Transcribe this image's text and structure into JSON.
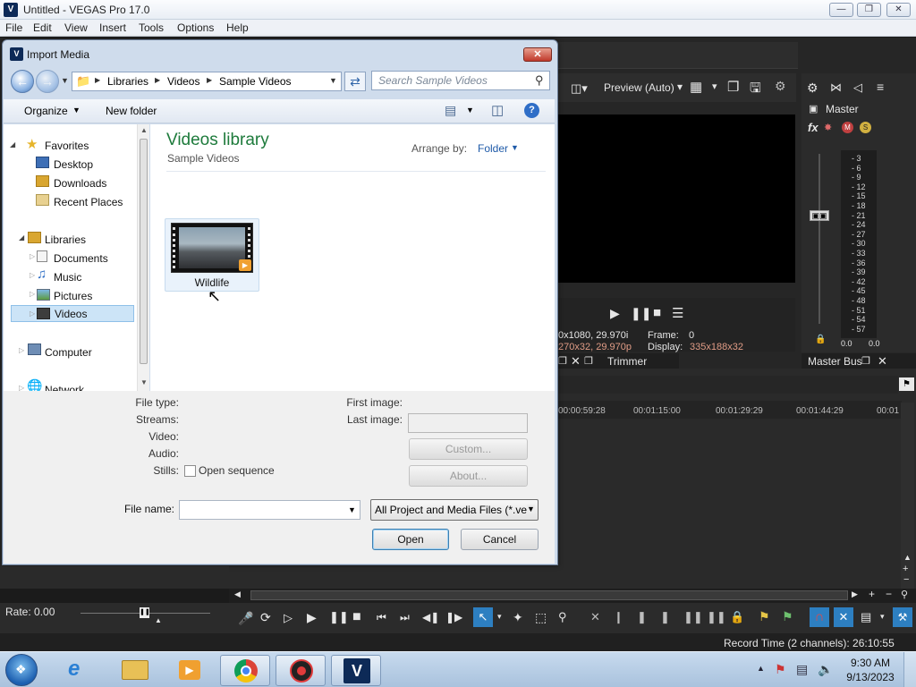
{
  "app": {
    "title": "Untitled - VEGAS Pro 17.0",
    "icon_letter": "V",
    "menu": [
      "File",
      "Edit",
      "View",
      "Insert",
      "Tools",
      "Options",
      "Help"
    ],
    "window_buttons": [
      "minimize",
      "restore",
      "close"
    ]
  },
  "preview": {
    "preview_mode": "Preview (Auto)",
    "project_info_1": "0x1080, 29.970i",
    "project_info_2": "270x32, 29.970p",
    "frame_label": "Frame:",
    "frame_value": "0",
    "display_label": "Display:",
    "display_value": "335x188x32",
    "tab_trimmer": "Trimmer"
  },
  "mixer": {
    "master_label": "Master",
    "db_scale": [
      "3",
      "6",
      "9",
      "12",
      "15",
      "18",
      "21",
      "24",
      "27",
      "30",
      "33",
      "36",
      "39",
      "42",
      "45",
      "48",
      "51",
      "54",
      "57"
    ],
    "left_value": "0.0",
    "right_value": "0.0",
    "tab_master_bus": "Master Bus"
  },
  "timeline": {
    "ruler": [
      "00:00:59:28",
      "00:01:15:00",
      "00:01:29:29",
      "00:01:44:29",
      "00:01"
    ],
    "rate_label": "Rate: 0.00"
  },
  "status": {
    "record_time": "Record Time (2 channels): 26:10:55"
  },
  "import_dialog": {
    "title": "Import Media",
    "breadcrumb": [
      "Libraries",
      "Videos",
      "Sample Videos"
    ],
    "search_placeholder": "Search Sample Videos",
    "organize_label": "Organize",
    "new_folder_label": "New folder",
    "nav": {
      "favorites": "Favorites",
      "desktop": "Desktop",
      "downloads": "Downloads",
      "recent_places": "Recent Places",
      "libraries": "Libraries",
      "documents": "Documents",
      "music": "Music",
      "pictures": "Pictures",
      "videos": "Videos",
      "computer": "Computer",
      "network": "Network"
    },
    "library_title": "Videos library",
    "library_subtitle": "Sample Videos",
    "arrange_label": "Arrange by:",
    "arrange_value": "Folder",
    "files": [
      {
        "name": "Wildlife"
      }
    ],
    "details": {
      "file_type": "File type:",
      "streams": "Streams:",
      "video": "Video:",
      "audio": "Audio:",
      "stills": "Stills:",
      "open_sequence": "Open sequence",
      "first_image": "First image:",
      "last_image": "Last image:",
      "custom_btn": "Custom...",
      "about_btn": "About..."
    },
    "file_name_label": "File name:",
    "file_name_value": "",
    "file_type_filter": "All Project and Media Files (*.ve",
    "open_btn": "Open",
    "cancel_btn": "Cancel"
  },
  "taskbar": {
    "time": "9:30 AM",
    "date": "9/13/2023",
    "apps": [
      "start-orb",
      "internet-explorer",
      "file-explorer",
      "media-player",
      "chrome",
      "recorder",
      "vegas-pro"
    ]
  },
  "colors": {
    "dialog_frame": "#cfdcec",
    "library_title": "#1e7b3c",
    "link_blue": "#1e5aa8",
    "info_salmon": "#e09c86",
    "taskbar": "#b5cce6"
  }
}
